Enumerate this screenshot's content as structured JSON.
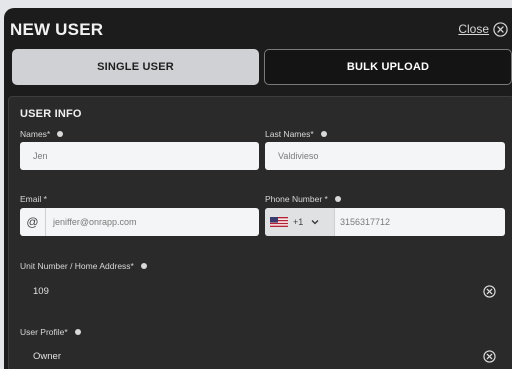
{
  "header": {
    "title": "NEW USER",
    "close_label": "Close"
  },
  "tabs": [
    {
      "label": "SINGLE USER",
      "active": true
    },
    {
      "label": "BULK UPLOAD",
      "active": false
    }
  ],
  "user_info": {
    "section_title": "USER INFO",
    "names": {
      "label": "Names*",
      "value": "Jen"
    },
    "last_names": {
      "label": "Last Names*",
      "value": "Valdivieso"
    },
    "email": {
      "label": "Email *",
      "prefix": "@",
      "value": "jeniffer@onrapp.com"
    },
    "phone": {
      "label": "Phone Number *",
      "country_code": "+1",
      "value": "3156317712"
    },
    "address": {
      "label": "Unit Number / Home Address*",
      "value": "109"
    },
    "profile": {
      "label": "User Profile*",
      "value": "Owner"
    }
  },
  "colors": {
    "modal_bg": "#1c1c1c",
    "section_bg": "#2a2a2a",
    "active_tab": "#cfd1d4",
    "input_bg": "#f4f5f6"
  },
  "icons": [
    "close-icon",
    "info-icon",
    "us-flag-icon",
    "chevron-down-icon",
    "clear-icon"
  ]
}
